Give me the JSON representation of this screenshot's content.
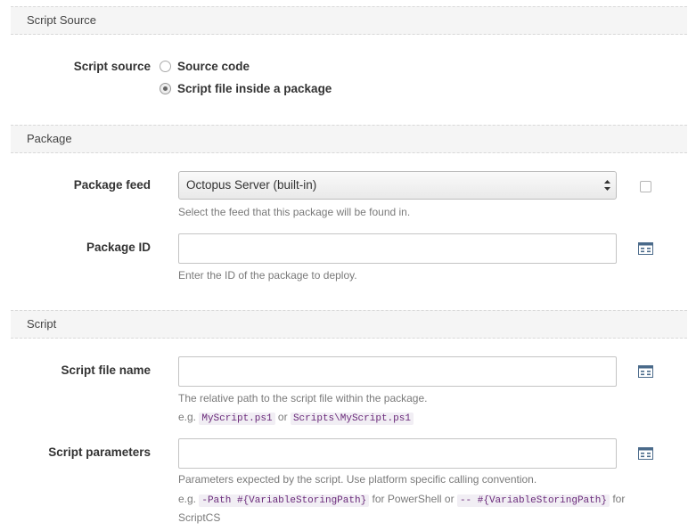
{
  "sections": {
    "script_source": "Script Source",
    "package": "Package",
    "script": "Script"
  },
  "script_source": {
    "label": "Script source",
    "options": [
      {
        "label": "Source code",
        "selected": false
      },
      {
        "label": "Script file inside a package",
        "selected": true
      }
    ]
  },
  "package_feed": {
    "label": "Package feed",
    "selected": "Octopus Server (built-in)",
    "help": "Select the feed that this package will be found in."
  },
  "package_id": {
    "label": "Package ID",
    "value": "",
    "help": "Enter the ID of the package to deploy."
  },
  "script_file_name": {
    "label": "Script file name",
    "value": "",
    "help": "The relative path to the script file within the package.",
    "example_prefix": "e.g.",
    "example_1": "MyScript.ps1",
    "example_or": "or",
    "example_2": "Scripts\\MyScript.ps1"
  },
  "script_parameters": {
    "label": "Script parameters",
    "value": "",
    "help": "Parameters expected by the script. Use platform specific calling convention.",
    "example_prefix": "e.g.",
    "example_1": "-Path #{VariableStoringPath}",
    "example_mid": "for PowerShell or",
    "example_2": "-- #{VariableStoringPath}",
    "example_suffix": "for ScriptCS"
  },
  "colors": {
    "header_bg": "#f5f5f5",
    "code_fg": "#6a2a7a",
    "code_bg": "#f1eef4",
    "help_text": "#7a7a7a"
  },
  "icons": {
    "variable": "variable-binding-icon"
  }
}
